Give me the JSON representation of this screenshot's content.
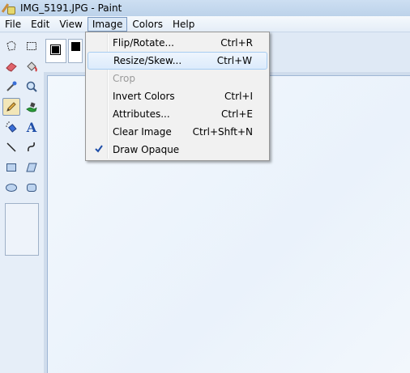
{
  "window": {
    "title": "IMG_5191.JPG - Paint"
  },
  "menubar": {
    "items": [
      {
        "label": "File"
      },
      {
        "label": "Edit"
      },
      {
        "label": "View"
      },
      {
        "label": "Image"
      },
      {
        "label": "Colors"
      },
      {
        "label": "Help"
      }
    ]
  },
  "image_menu": {
    "items": [
      {
        "label": "Flip/Rotate...",
        "shortcut": "Ctrl+R",
        "state": "normal"
      },
      {
        "label": "Resize/Skew...",
        "shortcut": "Ctrl+W",
        "state": "highlighted"
      },
      {
        "label": "Crop",
        "shortcut": "",
        "state": "disabled"
      },
      {
        "label": "Invert Colors",
        "shortcut": "Ctrl+I",
        "state": "normal"
      },
      {
        "label": "Attributes...",
        "shortcut": "Ctrl+E",
        "state": "normal"
      },
      {
        "label": "Clear Image",
        "shortcut": "Ctrl+Shft+N",
        "state": "normal"
      },
      {
        "label": "Draw Opaque",
        "shortcut": "",
        "state": "checked"
      }
    ]
  },
  "toolbox": {
    "tools": [
      {
        "icon": "free-form-select-icon"
      },
      {
        "icon": "rectangle-select-icon"
      },
      {
        "icon": "eraser-icon"
      },
      {
        "icon": "fill-bucket-icon"
      },
      {
        "icon": "color-picker-icon"
      },
      {
        "icon": "magnifier-icon"
      },
      {
        "icon": "pencil-icon",
        "selected": true
      },
      {
        "icon": "brush-icon"
      },
      {
        "icon": "airbrush-icon"
      },
      {
        "icon": "text-icon",
        "glyph": "A"
      },
      {
        "icon": "line-icon"
      },
      {
        "icon": "curve-icon"
      },
      {
        "icon": "rectangle-icon"
      },
      {
        "icon": "polygon-icon"
      },
      {
        "icon": "ellipse-icon"
      },
      {
        "icon": "rounded-rectangle-icon"
      }
    ]
  },
  "colors": {
    "foreground": "#000000",
    "background": "#ffffff",
    "accent": "#3a6fd8"
  }
}
